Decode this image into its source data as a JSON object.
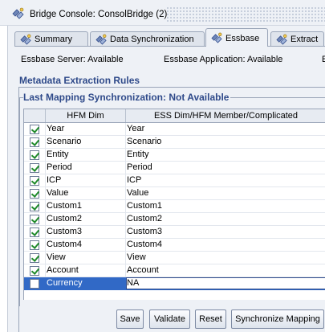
{
  "window": {
    "title": "Bridge Console: ConsolBridge (2)",
    "icon": "bridge-console-icon"
  },
  "tabs": [
    {
      "label": "Summary",
      "active": false,
      "icon": "console-icon"
    },
    {
      "label": "Data Synchronization",
      "active": false,
      "icon": "console-icon"
    },
    {
      "label": "Essbase",
      "active": true,
      "icon": "console-icon"
    },
    {
      "label": "Extract",
      "active": false,
      "icon": "console-icon"
    }
  ],
  "status": {
    "server": "Essbase Server: Available",
    "application": "Essbase Application: Available",
    "overflow": "E"
  },
  "section": {
    "title": "Metadata Extraction Rules",
    "group_title": "Last Mapping Synchronization: Not Available"
  },
  "grid": {
    "columns": [
      "",
      "HFM Dim",
      "ESS Dim/HFM Member/Complicated"
    ],
    "rows": [
      {
        "checked": true,
        "hfm": "Year",
        "ess": "Year"
      },
      {
        "checked": true,
        "hfm": "Scenario",
        "ess": "Scenario"
      },
      {
        "checked": true,
        "hfm": "Entity",
        "ess": "Entity"
      },
      {
        "checked": true,
        "hfm": "Period",
        "ess": "Period"
      },
      {
        "checked": true,
        "hfm": "ICP",
        "ess": "ICP"
      },
      {
        "checked": true,
        "hfm": "Value",
        "ess": "Value"
      },
      {
        "checked": true,
        "hfm": "Custom1",
        "ess": "Custom1"
      },
      {
        "checked": true,
        "hfm": "Custom2",
        "ess": "Custom2"
      },
      {
        "checked": true,
        "hfm": "Custom3",
        "ess": "Custom3"
      },
      {
        "checked": true,
        "hfm": "Custom4",
        "ess": "Custom4"
      },
      {
        "checked": true,
        "hfm": "View",
        "ess": "View"
      },
      {
        "checked": true,
        "hfm": "Account",
        "ess": "Account"
      },
      {
        "checked": false,
        "hfm": "Currency",
        "ess": "NA",
        "selected": true
      }
    ]
  },
  "buttons": {
    "save": "Save",
    "validate": "Validate",
    "reset": "Reset",
    "synchronize": "Synchronize Mapping"
  },
  "colors": {
    "accent_text": "#2f4a8a",
    "selection": "#3169c6",
    "background": "#eef1f6",
    "checkmark": "#1f8a2a"
  }
}
